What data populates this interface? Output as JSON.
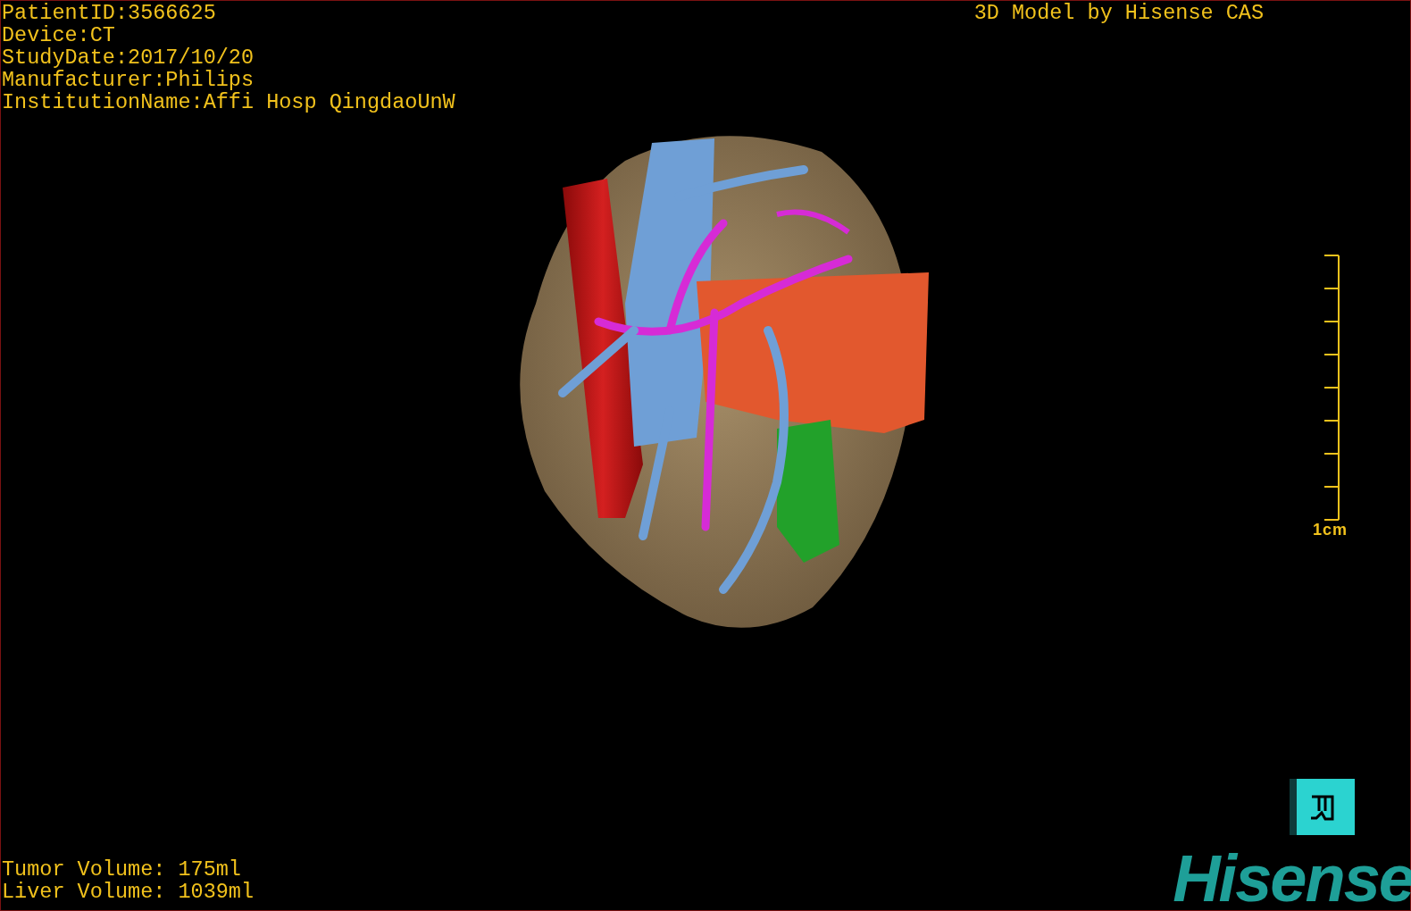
{
  "header": {
    "patient_info": [
      "PatientID:3566625",
      "Device:CT",
      "StudyDate:2017/10/20",
      "Manufacturer:Philips",
      "InstitutionName:Affi Hosp QingdaoUnW"
    ],
    "title": "3D Model by Hisense CAS"
  },
  "scale_bar": {
    "label": "1cm"
  },
  "volumes": [
    "Tumor Volume: 175ml",
    "Liver Volume: 1039ml"
  ],
  "logo": {
    "text": "Hisense"
  }
}
